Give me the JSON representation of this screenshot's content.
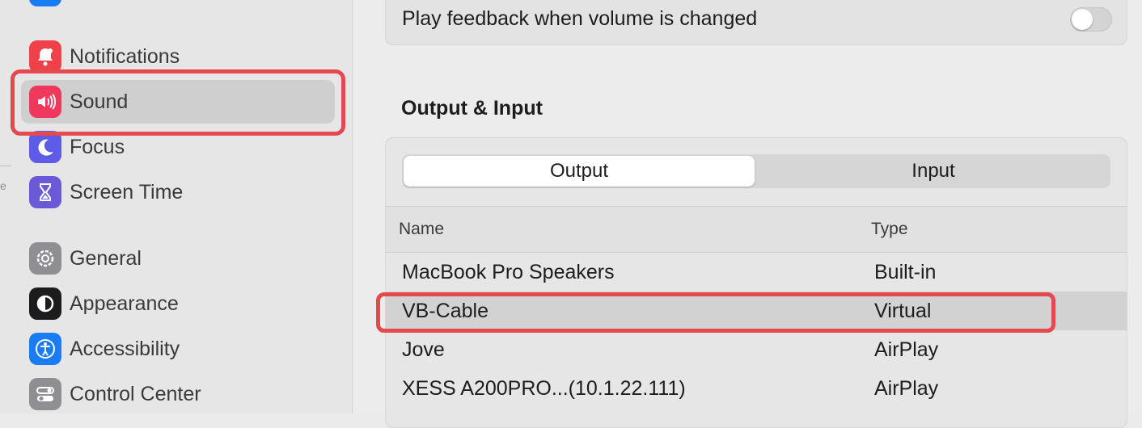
{
  "sidebar": {
    "items": [
      {
        "label": "Notifications",
        "icon": "bell-icon",
        "color": "#f0414b"
      },
      {
        "label": "Sound",
        "icon": "speaker-icon",
        "color": "#f0385c"
      },
      {
        "label": "Focus",
        "icon": "moon-icon",
        "color": "#5e5ce6"
      },
      {
        "label": "Screen Time",
        "icon": "hourglass-icon",
        "color": "#6a5ad8"
      },
      {
        "label": "General",
        "icon": "gear-icon",
        "color": "#8e8e93"
      },
      {
        "label": "Appearance",
        "icon": "appearance-icon",
        "color": "#1c1c1e"
      },
      {
        "label": "Accessibility",
        "icon": "accessibility-icon",
        "color": "#1a7cf3"
      },
      {
        "label": "Control Center",
        "icon": "toggles-icon",
        "color": "#8e8e93"
      }
    ],
    "selected": "Sound",
    "tick_text": "e"
  },
  "main": {
    "feedback": {
      "label": "Play feedback when volume is changed",
      "enabled": false
    },
    "section_title": "Output & Input",
    "tabs": [
      {
        "label": "Output",
        "active": true
      },
      {
        "label": "Input",
        "active": false
      }
    ],
    "table": {
      "columns": [
        "Name",
        "Type"
      ],
      "rows": [
        {
          "name": "MacBook Pro Speakers",
          "type": "Built-in"
        },
        {
          "name": "VB-Cable",
          "type": "Virtual"
        },
        {
          "name": "Jove",
          "type": "AirPlay"
        },
        {
          "name": "XESS A200PRO...(10.1.22.111)",
          "type": "AirPlay"
        }
      ],
      "selected_row": "VB-Cable"
    }
  },
  "colors": {
    "highlight": "#e5484d",
    "accent": "#1a7cf3"
  }
}
